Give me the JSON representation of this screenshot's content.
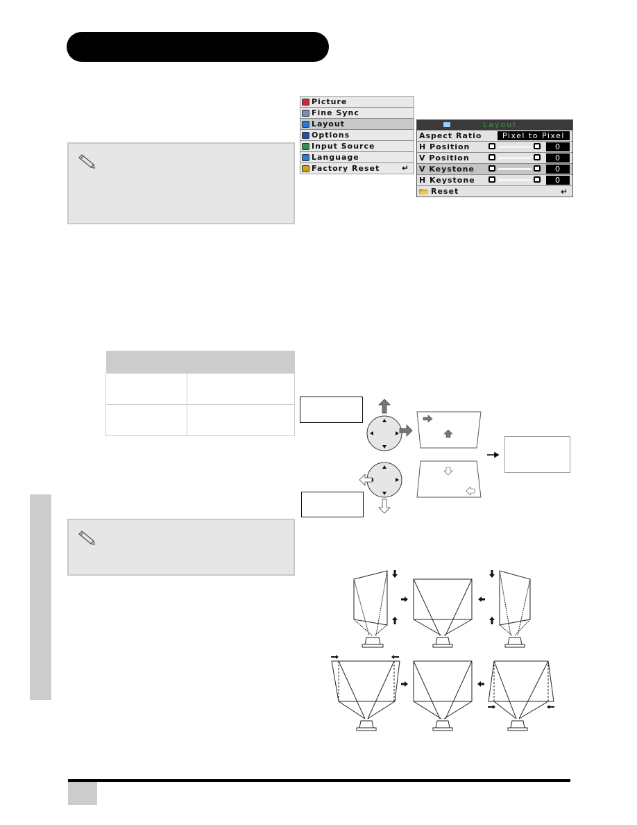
{
  "page": {
    "section_title": "",
    "side_tab_label": "",
    "page_number": ""
  },
  "main_menu": {
    "items": [
      {
        "label": "Picture",
        "icon": "picture-icon",
        "color": "#c03030",
        "selected": false
      },
      {
        "label": "Fine Sync",
        "icon": "fine-sync-icon",
        "color": "#7a8fb0",
        "selected": false
      },
      {
        "label": "Layout",
        "icon": "layout-icon",
        "color": "#2a7ad0",
        "selected": true
      },
      {
        "label": "Options",
        "icon": "options-icon",
        "color": "#2050b0",
        "selected": false
      },
      {
        "label": "Input Source",
        "icon": "input-source-icon",
        "color": "#3a8a5a",
        "selected": false
      },
      {
        "label": "Language",
        "icon": "language-icon",
        "color": "#2a80d0",
        "selected": false
      },
      {
        "label": "Factory Reset",
        "icon": "folder-icon",
        "color": "#d0a020",
        "selected": false,
        "enter": "↵"
      }
    ]
  },
  "layout_menu": {
    "title": "Layout",
    "title_color": "#3a9a3a",
    "aspect_ratio": {
      "label": "Aspect Ratio",
      "value": "Pixel to Pixel"
    },
    "rows": [
      {
        "label": "H Position",
        "value": "0",
        "slider_fraction": 0.5,
        "selected": false
      },
      {
        "label": "V Position",
        "value": "0",
        "slider_fraction": 0.5,
        "selected": false
      },
      {
        "label": "V Keystone",
        "value": "0",
        "slider_fraction": 0.5,
        "selected": true
      },
      {
        "label": "H Keystone",
        "value": "0",
        "slider_fraction": 0.5,
        "selected": false
      }
    ],
    "reset": {
      "label": "Reset",
      "enter": "↵"
    }
  },
  "notes": [
    {
      "icon": "pencil-icon",
      "text": ""
    },
    {
      "icon": "pencil-icon",
      "text": ""
    }
  ],
  "table": {
    "header": "",
    "rows": [
      [
        "",
        ""
      ],
      [
        "",
        ""
      ]
    ]
  },
  "diagram": {
    "label_top": "",
    "label_bottom": "",
    "label_result": ""
  }
}
